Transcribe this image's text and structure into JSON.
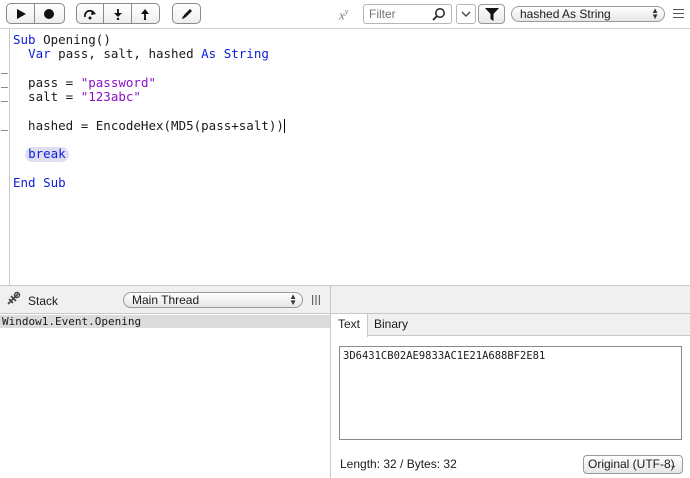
{
  "toolbar": {
    "run_group": [
      "play-icon",
      "stop-icon"
    ],
    "step_group": [
      "step-over-icon",
      "step-into-icon",
      "step-out-icon"
    ],
    "edit_icon": "pencil-icon"
  },
  "editor": {
    "lines": [
      [
        {
          "t": "Sub ",
          "c": "kw"
        },
        {
          "t": "Opening()",
          "c": "id"
        }
      ],
      [
        {
          "t": "  ",
          "c": "id"
        },
        {
          "t": "Var",
          "c": "kw"
        },
        {
          "t": " pass, salt, hashed ",
          "c": "id"
        },
        {
          "t": "As String",
          "c": "kw"
        }
      ],
      [],
      [
        {
          "t": "  pass = ",
          "c": "id"
        },
        {
          "t": "\"password\"",
          "c": "str"
        }
      ],
      [
        {
          "t": "  salt = ",
          "c": "id"
        },
        {
          "t": "\"123abc\"",
          "c": "str"
        }
      ],
      [],
      [
        {
          "t": "  hashed = EncodeHex(MD5(pass+salt))",
          "c": "id"
        },
        {
          "t": "",
          "c": "caret"
        }
      ],
      [],
      [
        {
          "t": "  ",
          "c": "id"
        },
        {
          "t": "break",
          "c": "brk"
        }
      ],
      [],
      [
        {
          "t": "End Sub",
          "c": "kw"
        }
      ]
    ]
  },
  "stack_panel": {
    "title": "Stack",
    "thread_selected": "Main Thread",
    "frames": [
      "Window1.Event.Opening"
    ]
  },
  "variables_panel": {
    "xy_glyph": "x",
    "xy_sup": "y",
    "filter_placeholder": "Filter",
    "selected_variable": "hashed As String",
    "tabs": [
      {
        "label": "Text",
        "active": true
      },
      {
        "label": "Binary",
        "active": false
      }
    ],
    "value_text": "3D6431CB02AE9833AC1E21A688BF2E81",
    "length_label": "Length: 32 / Bytes: 32",
    "encoding_selected": "Original (UTF-8)"
  }
}
